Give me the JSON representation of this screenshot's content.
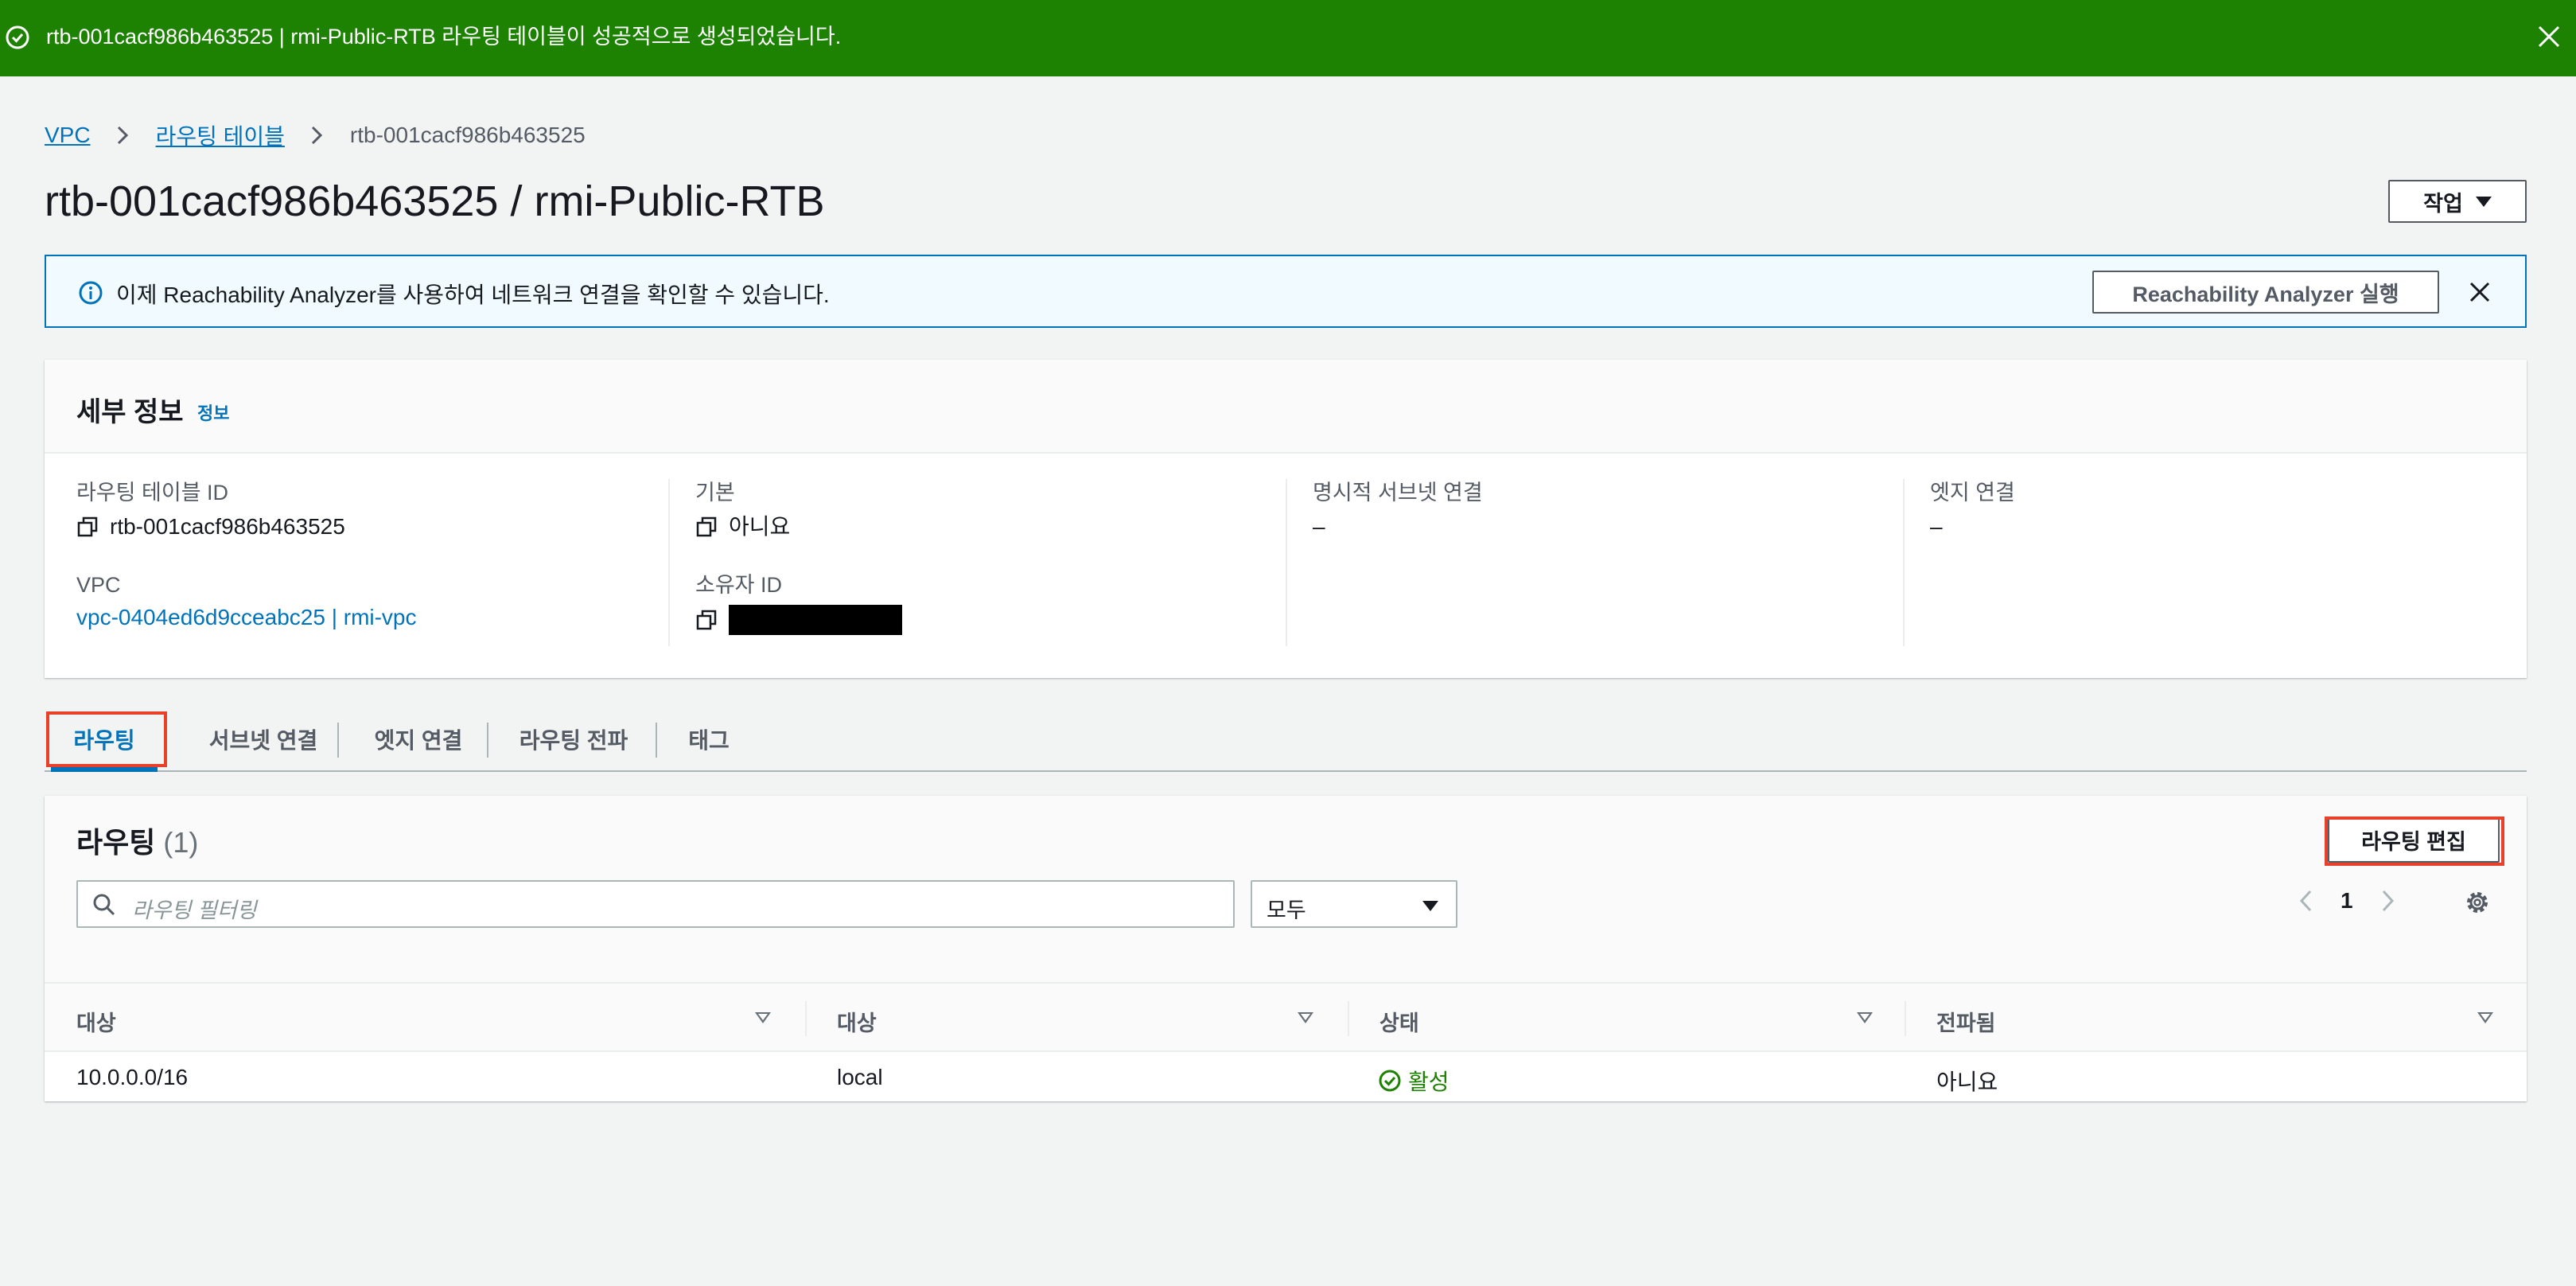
{
  "flash": {
    "message": "rtb-001cacf986b463525 | rmi-Public-RTB 라우팅 테이블이 성공적으로 생성되었습니다.",
    "color": "#1d8102"
  },
  "breadcrumb": [
    "VPC",
    "라우팅 테이블",
    "rtb-001cacf986b463525"
  ],
  "page_title": "rtb-001cacf986b463525 / rmi-Public-RTB",
  "actions_label": "작업",
  "info_banner": {
    "text": "이제 Reachability Analyzer를 사용하여 네트워크 연결을 확인할 수 있습니다.",
    "button": "Reachability Analyzer 실행"
  },
  "details": {
    "heading": "세부 정보",
    "info_link": "정보",
    "route_table_id_label": "라우팅 테이블 ID",
    "route_table_id": "rtb-001cacf986b463525",
    "vpc_label": "VPC",
    "vpc_value": "vpc-0404ed6d9cceabc25 | rmi-vpc",
    "main_label": "기본",
    "main_value": "아니요",
    "owner_label": "소유자 ID",
    "explicit_subnet_label": "명시적 서브넷 연결",
    "explicit_subnet_value": "–",
    "edge_label": "엣지 연결",
    "edge_value": "–"
  },
  "tabs": [
    "라우팅",
    "서브넷 연결",
    "엣지 연결",
    "라우팅 전파",
    "태그"
  ],
  "routes": {
    "heading": "라우팅",
    "count": "(1)",
    "edit_button": "라우팅 편집",
    "filter_placeholder": "라우팅 필터링",
    "filter_select": "모두",
    "page": "1",
    "columns": [
      "대상",
      "대상",
      "상태",
      "전파됨"
    ],
    "rows": [
      {
        "destination": "10.0.0.0/16",
        "target": "local",
        "status": "활성",
        "propagated": "아니요"
      }
    ]
  },
  "accent_color": "#0073bb",
  "highlight_color": "#e8412b"
}
